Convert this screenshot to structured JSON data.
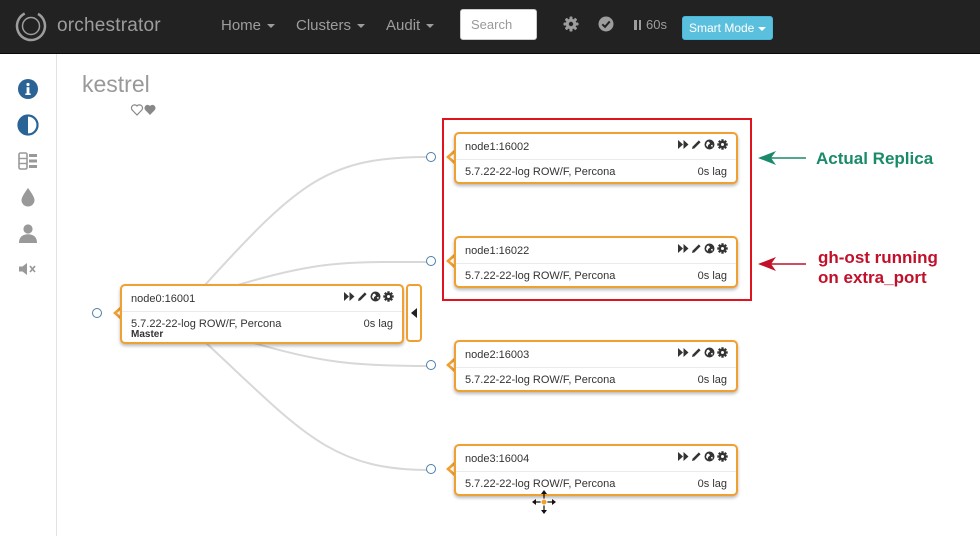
{
  "navbar": {
    "brand": "orchestrator",
    "menus": [
      {
        "label": "Home"
      },
      {
        "label": "Clusters"
      },
      {
        "label": "Audit"
      }
    ],
    "search_placeholder": "Search",
    "refresh_label": "60s",
    "mode_label": "Smart Mode"
  },
  "cluster": {
    "title": "kestrel"
  },
  "nodes": [
    {
      "name": "node0:16001",
      "version": "5.7.22-22-log ROW/F, Percona",
      "lag": "0s lag",
      "role": "Master"
    },
    {
      "name": "node1:16002",
      "version": "5.7.22-22-log ROW/F, Percona",
      "lag": "0s lag"
    },
    {
      "name": "node1:16022",
      "version": "5.7.22-22-log ROW/F, Percona",
      "lag": "0s lag"
    },
    {
      "name": "node2:16003",
      "version": "5.7.22-22-log ROW/F, Percona",
      "lag": "0s lag"
    },
    {
      "name": "node3:16004",
      "version": "5.7.22-22-log ROW/F, Percona",
      "lag": "0s lag"
    }
  ],
  "annotations": {
    "replica": "Actual Replica",
    "ghost_line1": "gh-ost running",
    "ghost_line2": "on extra_port",
    "green_color": "#1a8a6a",
    "red_color": "#c2102a"
  },
  "colors": {
    "navbar": "#222222",
    "node_border": "#f0a030",
    "mode_button": "#5bc0de",
    "highlight": "#e0141e"
  }
}
